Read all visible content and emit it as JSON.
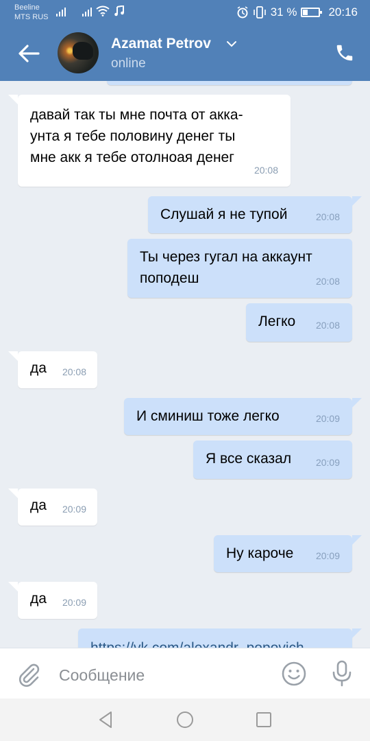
{
  "status_bar": {
    "carrier1": "Beeline",
    "carrier2": "MTS RUS",
    "battery": "31 %",
    "time": "20:16"
  },
  "header": {
    "name": "Azamat Petrov",
    "status": "online"
  },
  "messages": [
    {
      "dir": "in",
      "text": "давай так ты мне почта от акка-\nунта я тебе половину денег ты\nмне акк я тебе отолноая денег",
      "time": "20:08"
    },
    {
      "dir": "out",
      "text": "Слушай я не тупой",
      "time": "20:08"
    },
    {
      "dir": "out",
      "text": "Ты через гугал на аккаунт\nпоподеш",
      "time": "20:08"
    },
    {
      "dir": "out",
      "text": "Легко",
      "time": "20:08"
    },
    {
      "dir": "in",
      "text": "да",
      "time": "20:08"
    },
    {
      "dir": "out",
      "text": "И сминиш тоже легко",
      "time": "20:09"
    },
    {
      "dir": "out",
      "text": "Я все сказал",
      "time": "20:09"
    },
    {
      "dir": "in",
      "text": "да",
      "time": "20:09"
    },
    {
      "dir": "out",
      "text": "Ну кароче",
      "time": "20:09"
    },
    {
      "dir": "in",
      "text": "да",
      "time": "20:09"
    },
    {
      "dir": "out",
      "text": "https://vk.com/alexandr_popovich",
      "time": ""
    }
  ],
  "composer": {
    "placeholder": "Сообщение"
  },
  "colors": {
    "header": "#5181b8",
    "outgoing_bubble": "#cce0fa",
    "incoming_bubble": "#ffffff",
    "background": "#eaeef3"
  }
}
